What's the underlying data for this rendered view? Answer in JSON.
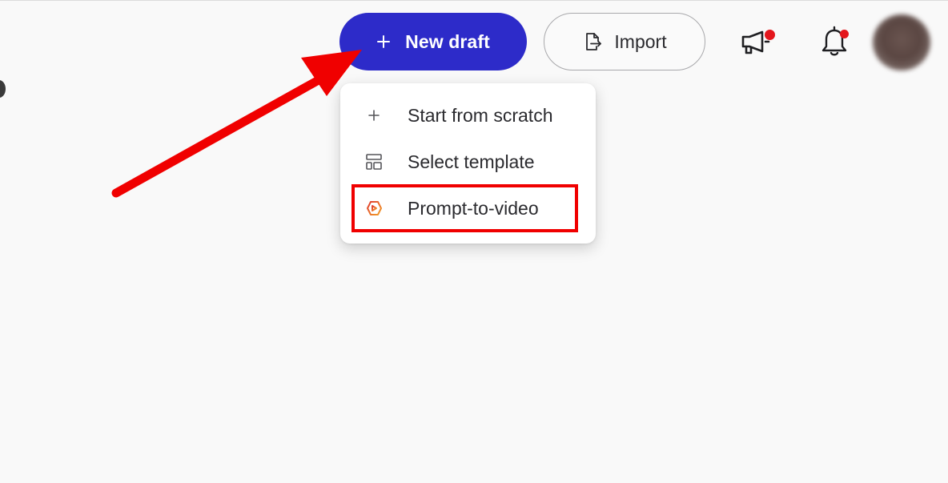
{
  "header": {
    "new_draft": {
      "icon": "plus-icon",
      "label": "New draft",
      "color": "#2d2bc9"
    },
    "import": {
      "icon": "file-export-icon",
      "label": "Import"
    },
    "announcements": {
      "icon": "megaphone-icon",
      "badge_color": "#e4161c"
    },
    "notifications": {
      "icon": "bell-icon",
      "badge_color": "#e4161c"
    },
    "avatar": {
      "icon": "user-avatar"
    }
  },
  "dropdown": {
    "items": [
      {
        "icon": "plus-icon",
        "label": "Start from scratch"
      },
      {
        "icon": "template-layout-icon",
        "label": "Select template"
      },
      {
        "icon": "prompt-to-video-icon",
        "label": "Prompt-to-video",
        "highlighted": true
      }
    ]
  },
  "annotations": {
    "arrow_color": "#f00000",
    "highlight_color": "#f00000"
  }
}
